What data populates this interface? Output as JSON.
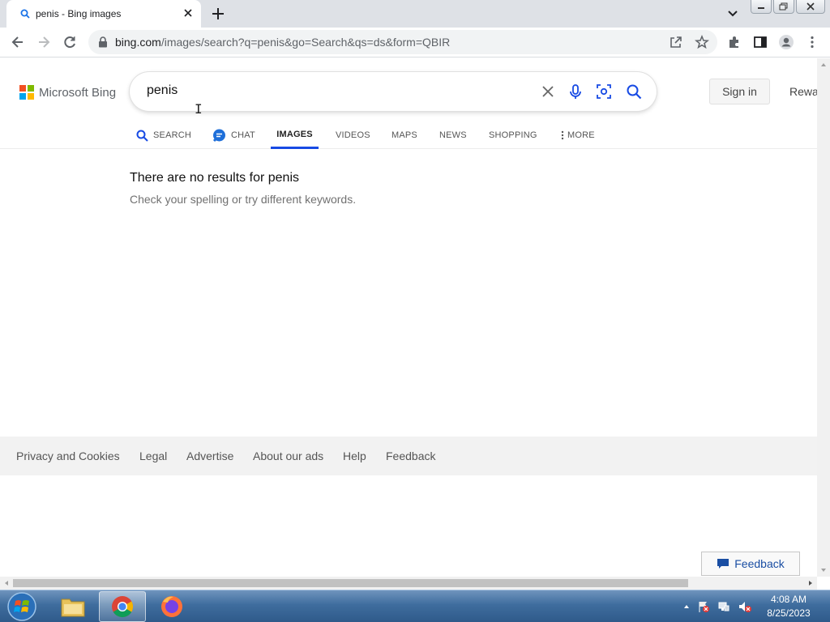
{
  "browser": {
    "tab_title": "penis - Bing images",
    "url_domain": "bing.com",
    "url_rest": "/images/search?q=penis&go=Search&qs=ds&form=QBIR"
  },
  "bing": {
    "brand": "Microsoft Bing",
    "query": "penis",
    "sign_in": "Sign in",
    "rewards": "Rewa",
    "nav": [
      "SEARCH",
      "CHAT",
      "IMAGES",
      "VIDEOS",
      "MAPS",
      "NEWS",
      "SHOPPING",
      "MORE"
    ],
    "active_nav": "IMAGES",
    "no_results": "There are no results for penis",
    "suggestion": "Check your spelling or try different keywords.",
    "footer": [
      "Privacy and Cookies",
      "Legal",
      "Advertise",
      "About our ads",
      "Help",
      "Feedback"
    ],
    "feedback_button": "Feedback"
  },
  "taskbar": {
    "time": "4:08 AM",
    "date": "8/25/2023"
  },
  "colors": {
    "accent": "#174ae4",
    "ms_red": "#f25022",
    "ms_green": "#7fba00",
    "ms_blue": "#00a4ef",
    "ms_yellow": "#ffb900"
  }
}
